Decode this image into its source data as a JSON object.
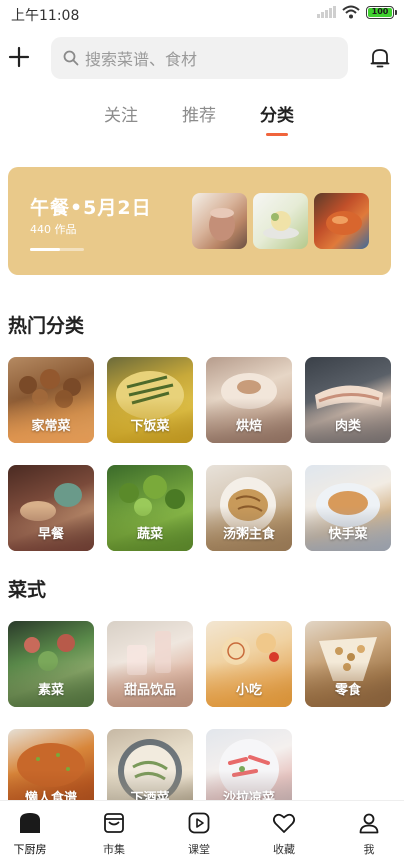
{
  "status_bar": {
    "time": "上午11:08",
    "battery": "100"
  },
  "search": {
    "placeholder": "搜索菜谱、食材"
  },
  "tabs": [
    {
      "label": "关注"
    },
    {
      "label": "推荐"
    },
    {
      "label": "分类"
    }
  ],
  "active_tab": "分类",
  "banner": {
    "title": "午餐•5月2日",
    "count": "440 作品",
    "progress": 0.55
  },
  "sections": {
    "hot_title": "热门分类",
    "style_title": "菜式"
  },
  "hot_categories": [
    {
      "label": "家常菜"
    },
    {
      "label": "下饭菜"
    },
    {
      "label": "烘焙"
    },
    {
      "label": "肉类"
    },
    {
      "label": "早餐"
    },
    {
      "label": "蔬菜"
    },
    {
      "label": "汤粥主食"
    },
    {
      "label": "快手菜"
    }
  ],
  "style_categories": [
    {
      "label": "素菜"
    },
    {
      "label": "甜品饮品"
    },
    {
      "label": "小吃"
    },
    {
      "label": "零食"
    },
    {
      "label": "懒人食谱"
    },
    {
      "label": "下酒菜"
    },
    {
      "label": "沙拉凉菜"
    }
  ],
  "bottom_nav": [
    {
      "label": "下厨房",
      "icon": "home-icon"
    },
    {
      "label": "市集",
      "icon": "market-icon"
    },
    {
      "label": "课堂",
      "icon": "play-icon"
    },
    {
      "label": "收藏",
      "icon": "heart-icon"
    },
    {
      "label": "我",
      "icon": "user-icon"
    }
  ],
  "colors": {
    "accent": "#f0643c",
    "banner": "#e9c98a",
    "search_bg": "#f1f1f1"
  }
}
